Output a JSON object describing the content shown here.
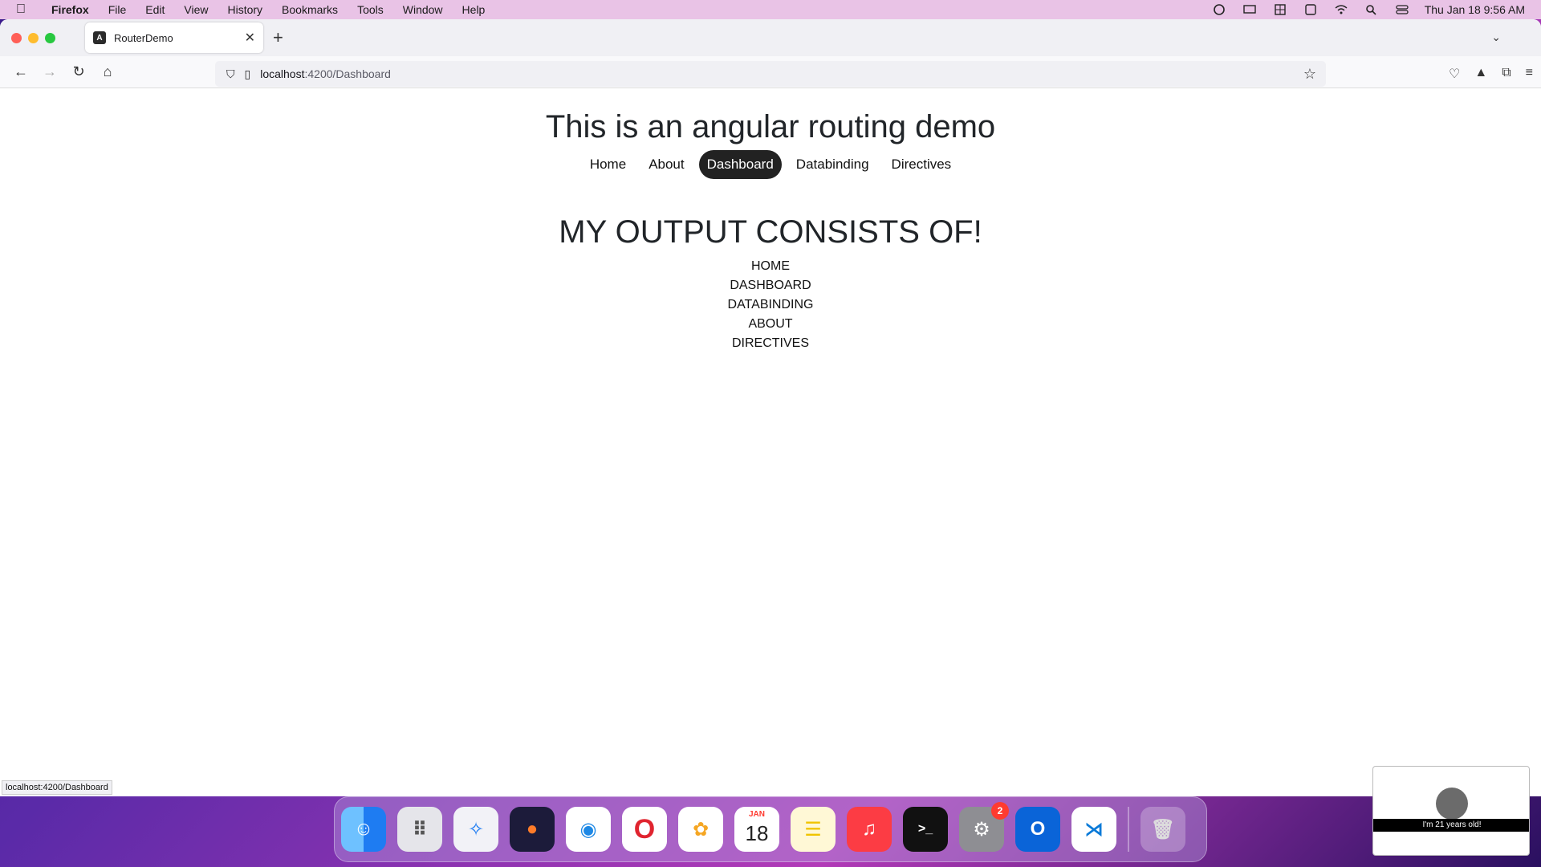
{
  "menubar": {
    "app": "Firefox",
    "items": [
      "File",
      "Edit",
      "View",
      "History",
      "Bookmarks",
      "Tools",
      "Window",
      "Help"
    ],
    "clock": "Thu Jan 18  9:56 AM"
  },
  "browser": {
    "tab": {
      "title": "RouterDemo",
      "favicon": "A"
    },
    "address": {
      "host": "localhost",
      "path": ":4200/Dashboard"
    },
    "status_link": "localhost:4200/Dashboard"
  },
  "page": {
    "title": "This is an angular routing demo",
    "nav": [
      {
        "label": "Home",
        "active": false
      },
      {
        "label": "About",
        "active": false
      },
      {
        "label": "Dashboard",
        "active": true
      },
      {
        "label": "Databinding",
        "active": false
      },
      {
        "label": "Directives",
        "active": false
      }
    ],
    "output_heading": "MY OUTPUT CONSISTS OF!",
    "output_items": [
      "HOME",
      "DASHBOARD",
      "DATABINDING",
      "ABOUT",
      "DIRECTIVES"
    ]
  },
  "dock": {
    "calendar": {
      "month": "JAN",
      "day": "18"
    },
    "settings_badge": "2"
  },
  "thumbnail": {
    "caption": "I'm 21 years old!"
  }
}
